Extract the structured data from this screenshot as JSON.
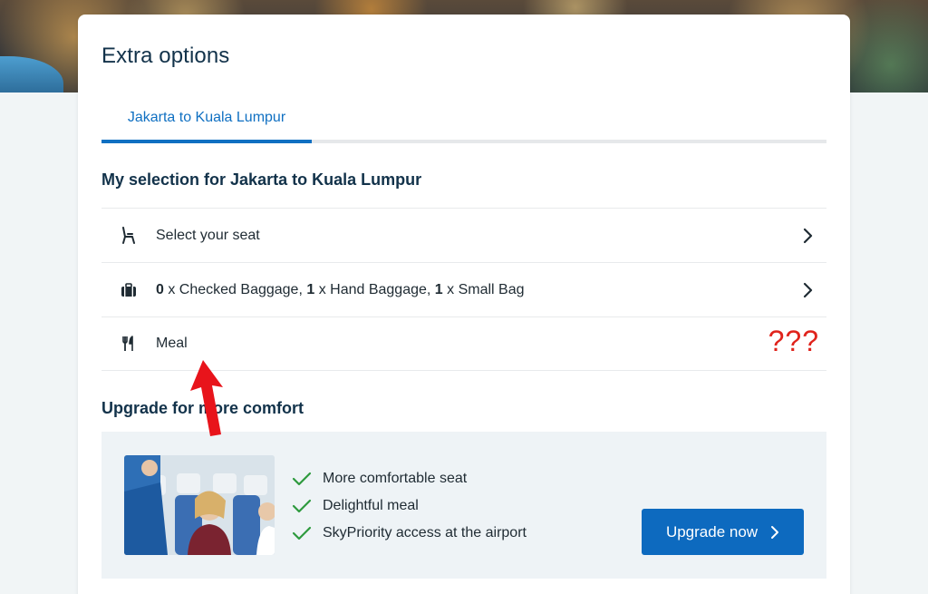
{
  "header": {
    "page_title": "Extra options"
  },
  "tabs": [
    {
      "label": "Jakarta to Kuala Lumpur",
      "active": true
    }
  ],
  "selection": {
    "title": "My selection for Jakarta to Kuala Lumpur",
    "rows": [
      {
        "icon": "seat-icon",
        "label": "Select your seat"
      },
      {
        "icon": "baggage-icon",
        "checked_count": "0",
        "checked_text": " x Checked Baggage, ",
        "hand_count": "1",
        "hand_text": " x Hand Baggage, ",
        "small_count": "1",
        "small_text": " x Small Bag"
      },
      {
        "icon": "meal-icon",
        "label": "Meal"
      }
    ]
  },
  "annotation": {
    "question_marks": "???",
    "color": "#e0231c"
  },
  "upgrade": {
    "title": "Upgrade for more comfort",
    "benefits": [
      "More comfortable seat",
      "Delightful meal",
      "SkyPriority access at the airport"
    ],
    "button_label": "Upgrade now"
  },
  "colors": {
    "accent": "#1070c2",
    "button": "#0d6abf",
    "check": "#2e9a3e"
  }
}
